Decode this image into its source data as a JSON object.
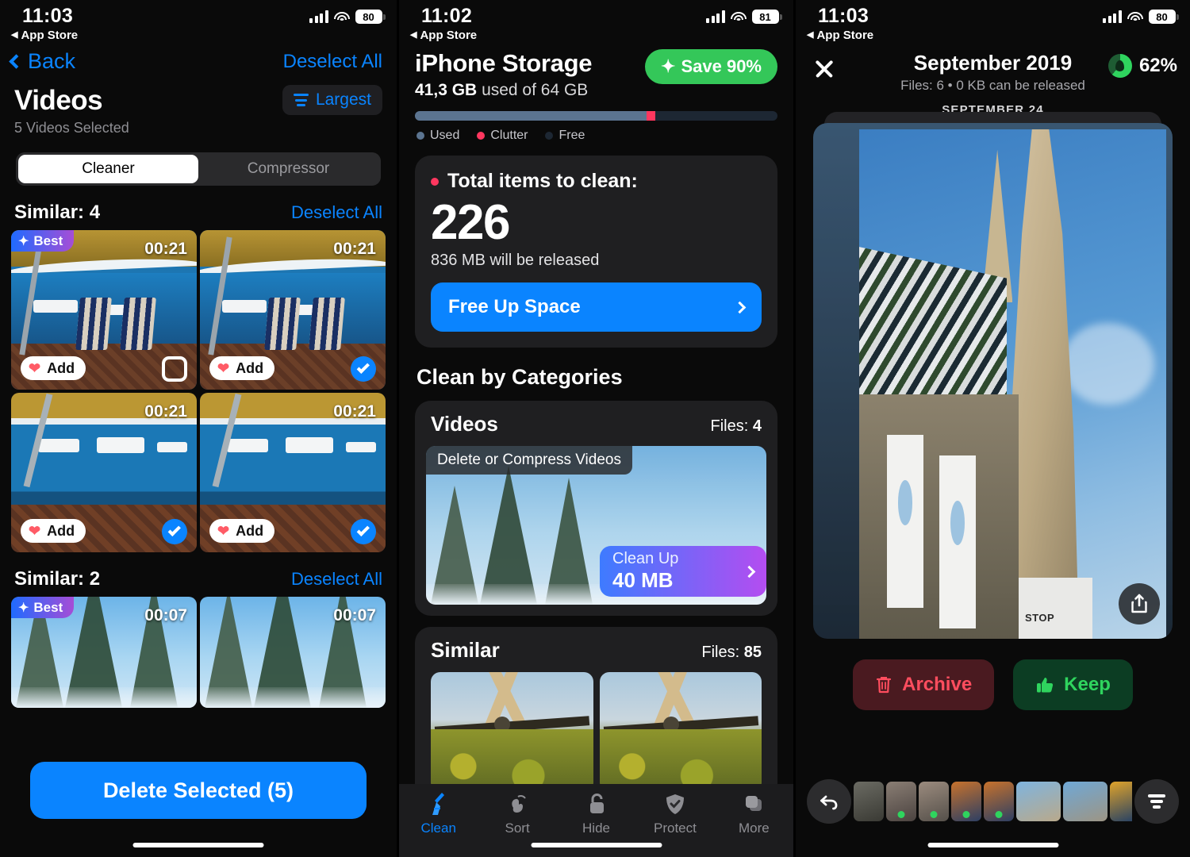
{
  "screen1": {
    "status": {
      "time": "11:03",
      "back_app": "App Store",
      "battery": "80"
    },
    "nav": {
      "back_label": "Back",
      "action_label": "Deselect All"
    },
    "title": "Videos",
    "subtitle": "5 Videos Selected",
    "sort_button": {
      "label": "Largest",
      "icon": "sort-descending-icon"
    },
    "segmented": {
      "options": [
        "Cleaner",
        "Compressor"
      ],
      "selected": "Cleaner"
    },
    "sections": [
      {
        "title": "Similar: 4",
        "action": "Deselect All",
        "items": [
          {
            "duration": "00:21",
            "best": true,
            "best_label": "Best",
            "add_label": "Add",
            "selected": false
          },
          {
            "duration": "00:21",
            "best": false,
            "add_label": "Add",
            "selected": true
          },
          {
            "duration": "00:21",
            "best": false,
            "add_label": "Add",
            "selected": true
          },
          {
            "duration": "00:21",
            "best": false,
            "add_label": "Add",
            "selected": true
          }
        ]
      },
      {
        "title": "Similar: 2",
        "action": "Deselect All",
        "items": [
          {
            "duration": "00:07",
            "best": true,
            "best_label": "Best",
            "selected": false
          },
          {
            "duration": "00:07",
            "best": false,
            "selected": false
          }
        ]
      }
    ],
    "delete_button": "Delete Selected (5)"
  },
  "screen2": {
    "status": {
      "time": "11:02",
      "back_app": "App Store",
      "battery": "81"
    },
    "title": "iPhone Storage",
    "usage_used": "41,3 GB",
    "usage_rest": "used of 64 GB",
    "save_pill": "Save 90%",
    "legend": [
      "Used",
      "Clutter",
      "Free"
    ],
    "total_card": {
      "heading": "Total items to clean:",
      "count": "226",
      "released": "836 MB will be released",
      "cta": "Free Up Space"
    },
    "section_title": "Clean by Categories",
    "categories": [
      {
        "name": "Videos",
        "files_label": "Files:",
        "files_value": "4",
        "media_label": "Delete or Compress Videos",
        "cleanup_label": "Clean Up",
        "cleanup_value": "40 MB"
      },
      {
        "name": "Similar",
        "files_label": "Files:",
        "files_value": "85"
      }
    ],
    "tabs": [
      {
        "label": "Clean",
        "icon": "broom-icon",
        "active": true
      },
      {
        "label": "Sort",
        "icon": "swipe-hand-icon",
        "active": false
      },
      {
        "label": "Hide",
        "icon": "lock-icon",
        "active": false
      },
      {
        "label": "Protect",
        "icon": "shield-check-icon",
        "active": false
      },
      {
        "label": "More",
        "icon": "stacked-squares-icon",
        "active": false
      }
    ]
  },
  "screen3": {
    "status": {
      "time": "11:03",
      "back_app": "App Store",
      "battery": "80"
    },
    "title": "September 2019",
    "subtitle": "Files: 6 • 0 KB can be released",
    "percent": "62%",
    "deck_label": "SEPTEMBER 24",
    "share_icon": "share-icon",
    "actions": [
      {
        "label": "Archive",
        "icon": "trash-icon"
      },
      {
        "label": "Keep",
        "icon": "thumbs-up-icon"
      }
    ],
    "filmstrip": {
      "undo_icon": "undo-icon",
      "filter_icon": "filter-icon",
      "thumbs": [
        {
          "kept": false
        },
        {
          "kept": true
        },
        {
          "kept": true
        },
        {
          "kept": true
        },
        {
          "kept": true
        },
        {
          "kept": false
        },
        {
          "kept": false
        },
        {
          "kept": false
        },
        {
          "kept": false
        },
        {
          "kept": false
        },
        {
          "kept": false
        }
      ]
    }
  },
  "colors": {
    "accent_blue": "#0a84ff",
    "green": "#34c759",
    "red": "#ff375f",
    "purple": "#b44df0"
  }
}
